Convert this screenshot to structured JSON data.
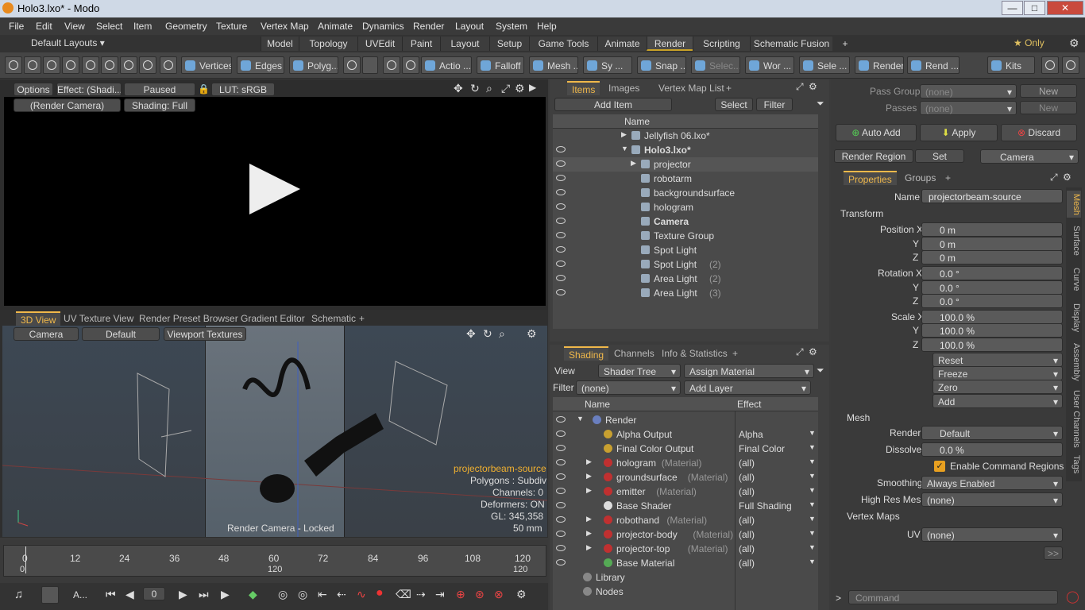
{
  "window": {
    "title": "Holo3.lxo* - Modo",
    "minimize": "—",
    "maximize": "□",
    "close": "✕"
  },
  "menu": [
    "File",
    "Edit",
    "View",
    "Select",
    "Item",
    "Geometry",
    "Texture",
    "Vertex Map",
    "Animate",
    "Dynamics",
    "Render",
    "Layout",
    "System",
    "Help"
  ],
  "layout_selector": "Default Layouts ▾",
  "layout_tabs": [
    "Model",
    "Topology",
    "UVEdit",
    "Paint",
    "Layout",
    "Setup",
    "Game Tools",
    "Animate",
    "Render",
    "Scripting",
    "Schematic Fusion",
    "+"
  ],
  "layout_active": "Render",
  "only_label": "★ Only",
  "toolbar": {
    "vertices": "Vertices",
    "edges": "Edges",
    "polygons": "Polyg...",
    "action": "Actio ...",
    "falloff": "Falloff",
    "mesh": "Mesh ...",
    "sym": "Sy ...",
    "snap": "Snap ...",
    "select": "Selec...",
    "work": "Wor ...",
    "sele": "Sele ...",
    "render": "Render",
    "rend": "Rend ...",
    "kits": "Kits"
  },
  "render_view": {
    "options": "Options",
    "effect": "Effect: (Shadi...",
    "paused": "Paused",
    "lut": "LUT: sRGB",
    "camera": "(Render Camera)",
    "shading": "Shading: Full"
  },
  "viewport_tabs": [
    "3D View",
    "UV Texture View",
    "Render Preset Browser",
    "Gradient Editor",
    "Schematic",
    "+"
  ],
  "viewport_bar": {
    "camera": "Camera",
    "default": "Default",
    "textures": "Viewport Textures"
  },
  "viewport_info": {
    "selected": "projectorbeam-source",
    "polygons": "Polygons : Subdiv",
    "channels": "Channels: 0",
    "deformers": "Deformers: ON",
    "gl": "GL: 345,358",
    "lens": "50 mm",
    "locked": "Render Camera - Locked"
  },
  "timeline": {
    "ticks": [
      "0",
      "12",
      "24",
      "36",
      "48",
      "60",
      "72",
      "84",
      "96",
      "108",
      "120"
    ],
    "start": "0",
    "end_mid": "120",
    "end": "120",
    "frame": "0",
    "anim": "A..."
  },
  "items_panel": {
    "tabs": [
      "Items",
      "Images",
      "Vertex Map List",
      "+"
    ],
    "add_item": "Add Item",
    "select": "Select",
    "filter": "Filter",
    "col_name": "Name",
    "rows": [
      {
        "name": "Jellyfish 06.lxo*",
        "suffix": "",
        "bold": false,
        "indent": 0,
        "expander": "▶"
      },
      {
        "name": "Holo3.lxo*",
        "suffix": "",
        "bold": true,
        "indent": 0,
        "expander": "▼"
      },
      {
        "name": "projector",
        "suffix": "",
        "bold": false,
        "indent": 1,
        "expander": "▶"
      },
      {
        "name": "robotarm",
        "suffix": "",
        "bold": false,
        "indent": 1,
        "expander": ""
      },
      {
        "name": "backgroundsurface",
        "suffix": "",
        "bold": false,
        "indent": 1,
        "expander": ""
      },
      {
        "name": "hologram",
        "suffix": "",
        "bold": false,
        "indent": 1,
        "expander": ""
      },
      {
        "name": "Camera",
        "suffix": "",
        "bold": true,
        "indent": 1,
        "expander": ""
      },
      {
        "name": "Texture Group",
        "suffix": "",
        "bold": false,
        "indent": 1,
        "expander": ""
      },
      {
        "name": "Spot Light",
        "suffix": "",
        "bold": false,
        "indent": 1,
        "expander": ""
      },
      {
        "name": "Spot Light",
        "suffix": "(2)",
        "bold": false,
        "indent": 1,
        "expander": ""
      },
      {
        "name": "Area Light",
        "suffix": "(2)",
        "bold": false,
        "indent": 1,
        "expander": ""
      },
      {
        "name": "Area Light",
        "suffix": "(3)",
        "bold": false,
        "indent": 1,
        "expander": ""
      }
    ]
  },
  "shading_panel": {
    "tabs": [
      "Shading",
      "Channels",
      "Info & Statistics",
      "+"
    ],
    "view_label": "View",
    "view_value": "Shader Tree",
    "assign": "Assign Material",
    "filter_label": "Filter",
    "filter_value": "(none)",
    "add_layer": "Add Layer",
    "col_name": "Name",
    "col_effect": "Effect",
    "rows": [
      {
        "name": "Render",
        "suffix": "",
        "effect": "",
        "level": 0
      },
      {
        "name": "Alpha Output",
        "suffix": "",
        "effect": "Alpha",
        "level": 1
      },
      {
        "name": "Final Color Output",
        "suffix": "",
        "effect": "Final Color",
        "level": 1
      },
      {
        "name": "hologram",
        "suffix": "(Material)",
        "effect": "(all)",
        "level": 1
      },
      {
        "name": "groundsurface",
        "suffix": "(Material)",
        "effect": "(all)",
        "level": 1
      },
      {
        "name": "emitter",
        "suffix": "(Material)",
        "effect": "(all)",
        "level": 1
      },
      {
        "name": "Base Shader",
        "suffix": "",
        "effect": "Full Shading",
        "level": 1
      },
      {
        "name": "robothand",
        "suffix": "(Material)",
        "effect": "(all)",
        "level": 1
      },
      {
        "name": "projector-body",
        "suffix": "(Material)",
        "effect": "(all)",
        "level": 1
      },
      {
        "name": "projector-top",
        "suffix": "(Material)",
        "effect": "(all)",
        "level": 1
      },
      {
        "name": "Base Material",
        "suffix": "",
        "effect": "(all)",
        "level": 1
      },
      {
        "name": "Library",
        "suffix": "",
        "effect": "",
        "level": 0
      },
      {
        "name": "Nodes",
        "suffix": "",
        "effect": "",
        "level": 0
      }
    ]
  },
  "pass": {
    "groups_label": "Pass Groups",
    "groups_value": "(none)",
    "passes_label": "Passes",
    "passes_value": "(none)",
    "new": "New",
    "auto_add": "Auto Add",
    "apply": "Apply",
    "discard": "Discard",
    "render_region": "Render Region",
    "set": "Set",
    "camera": "Camera"
  },
  "properties": {
    "tabs": [
      "Properties",
      "Groups",
      "+"
    ],
    "name_label": "Name",
    "name_value": "projectorbeam-source",
    "transform": "Transform",
    "pos_labels": [
      "Position X",
      "Y",
      "Z"
    ],
    "pos": [
      "0 m",
      "0 m",
      "0 m"
    ],
    "rot_labels": [
      "Rotation X",
      "Y",
      "Z"
    ],
    "rot": [
      "0.0 °",
      "0.0 °",
      "0.0 °"
    ],
    "scale_labels": [
      "Scale X",
      "Y",
      "Z"
    ],
    "scale": [
      "100.0 %",
      "100.0 %",
      "100.0 %"
    ],
    "actions": [
      "Reset",
      "Freeze",
      "Zero",
      "Add"
    ],
    "mesh": "Mesh",
    "render_label": "Render",
    "render_value": "Default",
    "dissolve_label": "Dissolve",
    "dissolve_value": "0.0 %",
    "cmd_regions": "Enable Command Regions",
    "smoothing_label": "Smoothing",
    "smoothing_value": "Always Enabled",
    "hires_label": "High Res Mesh",
    "hires_value": "(none)",
    "vmaps": "Vertex Maps",
    "uv_label": "UV",
    "uv_value": "(none)",
    "more": ">>"
  },
  "side_tabs": [
    "Mesh",
    "Surface",
    "Curve",
    "Display",
    "Assembly",
    "User Channels",
    "Tags"
  ],
  "command": {
    "placeholder": "Command",
    "prompt": ">"
  }
}
